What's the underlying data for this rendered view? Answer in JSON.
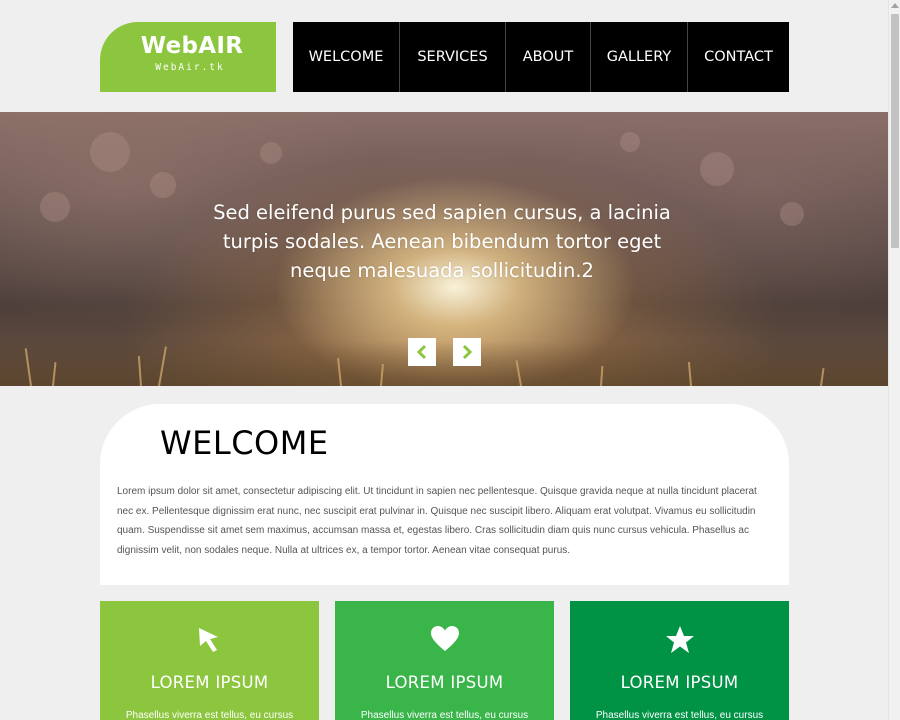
{
  "colors": {
    "logo_green": "#8cc63f",
    "feature1": "#8cc63f",
    "feature2": "#39b54a",
    "feature3": "#009245",
    "nav_bg": "#000000",
    "page_bg": "#efefef"
  },
  "header": {
    "logo_title": "WebAIR",
    "logo_sub": "WebAir.tk"
  },
  "nav": {
    "items": [
      "WELCOME",
      "SERVICES",
      "ABOUT",
      "GALLERY",
      "CONTACT"
    ]
  },
  "hero": {
    "caption": "Sed eleifend purus sed sapien cursus, a lacinia turpis sodales. Aenean bibendum tortor eget neque malesuada sollicitudin.2",
    "prev_icon": "chevron-left-icon",
    "next_icon": "chevron-right-icon"
  },
  "welcome": {
    "title": "WELCOME",
    "body": "Lorem ipsum dolor sit amet, consectetur adipiscing elit. Ut tincidunt in sapien nec pellentesque. Quisque gravida neque at nulla tincidunt placerat nec ex. Pellentesque dignissim erat nunc, nec suscipit erat pulvinar in. Quisque nec suscipit libero. Aliquam erat volutpat. Vivamus eu sollicitudin quam. Suspendisse sit amet sem maximus, accumsan massa et, egestas libero. Cras sollicitudin diam quis nunc cursus vehicula. Phasellus ac dignissim velit, non sodales neque. Nulla at ultrices ex, a tempor tortor. Aenean vitae consequat purus."
  },
  "features": [
    {
      "icon": "cursor-icon",
      "title": "LOREM IPSUM",
      "text": "Phasellus viverra est tellus, eu cursus"
    },
    {
      "icon": "heart-icon",
      "title": "LOREM IPSUM",
      "text": "Phasellus viverra est tellus, eu cursus"
    },
    {
      "icon": "star-icon",
      "title": "LOREM IPSUM",
      "text": "Phasellus viverra est tellus, eu cursus"
    }
  ]
}
